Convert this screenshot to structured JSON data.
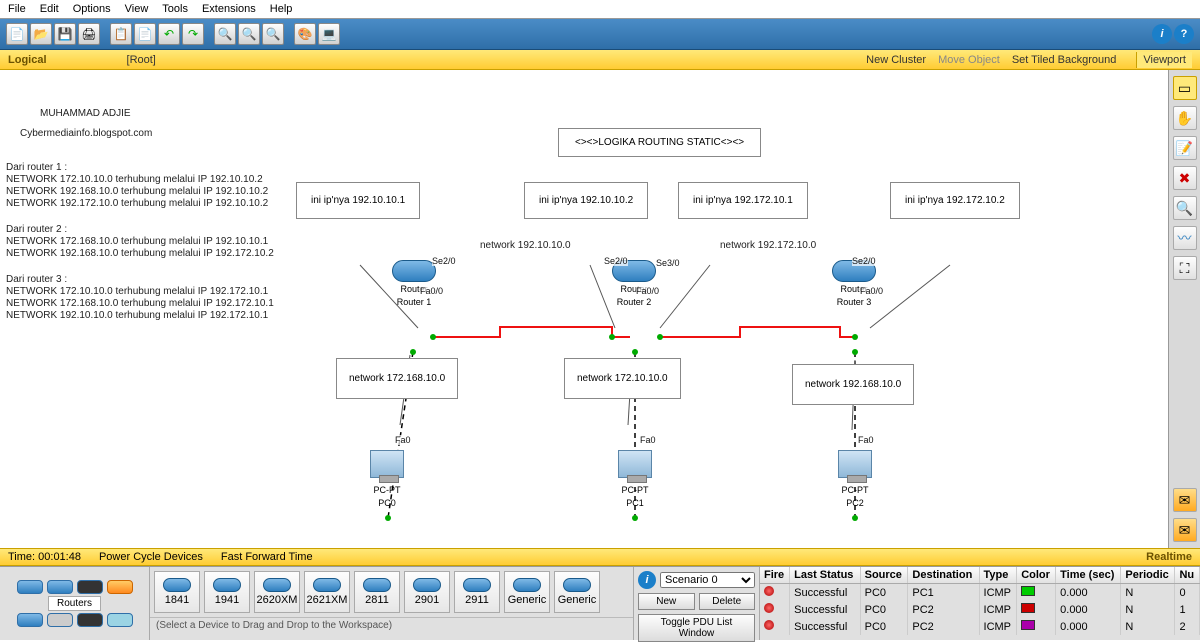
{
  "menu": {
    "items": [
      "File",
      "Edit",
      "Options",
      "View",
      "Tools",
      "Extensions",
      "Help"
    ]
  },
  "viewbar": {
    "logical": "Logical",
    "root": "[Root]",
    "new_cluster": "New Cluster",
    "move_object": "Move Object",
    "set_bg": "Set Tiled Background",
    "viewport": "Viewport"
  },
  "canvas": {
    "author": "MUHAMMAD ADJIE",
    "website": "Cybermediainfo.blogspot.com",
    "title_box": "<><>LOGIKA ROUTING STATIC<><>",
    "r1": {
      "header": "Dari router 1 :",
      "lines": [
        "NETWORK 172.10.10.0 terhubung melalui IP 192.10.10.2",
        "NETWORK 192.168.10.0 terhubung melalui IP 192.10.10.2",
        "NETWORK 192.172.10.0 terhubung melalui IP 192.10.10.2"
      ]
    },
    "r2": {
      "header": "Dari router 2 :",
      "lines": [
        "NETWORK 172.168.10.0 terhubung melalui IP 192.10.10.1",
        "NETWORK 192.168.10.0 terhubung melalui IP 192.172.10.2"
      ]
    },
    "r3": {
      "header": "Dari router 3 :",
      "lines": [
        "NETWORK 172.10.10.0 terhubung melalui IP 192.172.10.1",
        "NETWORK 172.168.10.0 terhubung melalui IP 192.172.10.1",
        "NETWORK 192.10.10.0 terhubung melalui IP 192.172.10.1"
      ]
    },
    "ip1": "ini ip'nya 192.10.10.1",
    "ip2": "ini ip'nya 192.10.10.2",
    "ip3": "ini ip'nya 192.172.10.1",
    "ip4": "ini ip'nya 192.172.10.2",
    "net_ab": "network 192.10.10.0",
    "net_bc": "network 192.172.10.0",
    "net_pc0": "network 172.168.10.0",
    "net_pc1": "network 172.10.10.0",
    "net_pc2": "network 192.168.10.0",
    "router1": {
      "type": "Router",
      "name": "Router 1"
    },
    "router2": {
      "type": "Router",
      "name": "Router 2"
    },
    "router3": {
      "type": "Router",
      "name": "Router 3"
    },
    "pc0": {
      "type": "PC-PT",
      "name": "PC0"
    },
    "pc1": {
      "type": "PC-PT",
      "name": "PC1"
    },
    "pc2": {
      "type": "PC-PT",
      "name": "PC2"
    },
    "ports": {
      "r1_se20": "Se2/0",
      "r1_fa00": "Fa0/0",
      "r2_se20": "Se2/0",
      "r2_se30": "Se3/0",
      "r2_fa00": "Fa0/0",
      "r3_se20": "Se2/0",
      "r3_fa00": "Fa0/0",
      "fa0": "Fa0"
    }
  },
  "timebar": {
    "time": "Time: 00:01:48",
    "powercycle": "Power Cycle Devices",
    "fastfwd": "Fast Forward Time",
    "realtime": "Realtime"
  },
  "bottom": {
    "cat_label": "Routers",
    "devices": [
      "1841",
      "1941",
      "2620XM",
      "2621XM",
      "2811",
      "2901",
      "2911",
      "Generic",
      "Generic"
    ],
    "draghint": "(Select a Device to Drag and Drop to the Workspace)",
    "scenario": {
      "selected": "Scenario 0",
      "new": "New",
      "delete": "Delete",
      "toggle": "Toggle PDU List Window"
    },
    "pdu": {
      "headers": [
        "Fire",
        "Last Status",
        "Source",
        "Destination",
        "Type",
        "Color",
        "Time (sec)",
        "Periodic",
        "Nu"
      ],
      "rows": [
        {
          "status": "Successful",
          "src": "PC0",
          "dst": "PC1",
          "type": "ICMP",
          "color": "#00cc00",
          "time": "0.000",
          "periodic": "N",
          "num": "0"
        },
        {
          "status": "Successful",
          "src": "PC0",
          "dst": "PC2",
          "type": "ICMP",
          "color": "#cc0000",
          "time": "0.000",
          "periodic": "N",
          "num": "1"
        },
        {
          "status": "Successful",
          "src": "PC0",
          "dst": "PC2",
          "type": "ICMP",
          "color": "#aa00aa",
          "time": "0.000",
          "periodic": "N",
          "num": "2"
        }
      ]
    }
  }
}
